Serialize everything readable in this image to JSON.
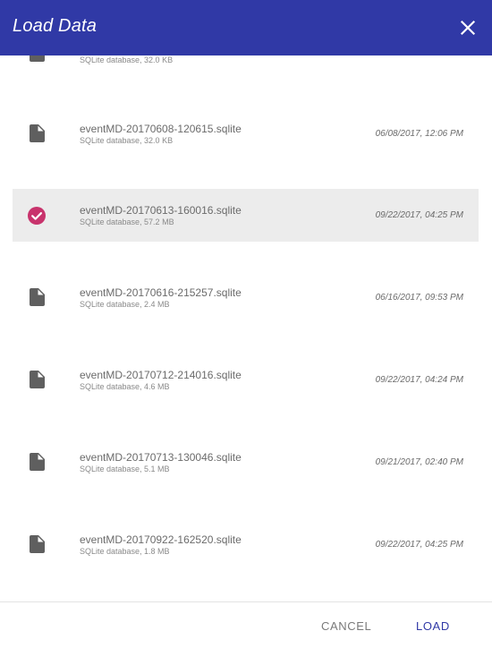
{
  "header": {
    "title": "Load Data",
    "close_icon": "close-icon"
  },
  "files": [
    {
      "name": "",
      "meta": "SQLite database, 32.0 KB",
      "date": "",
      "icon": "file-icon",
      "selected": false
    },
    {
      "name": "eventMD-20170608-120615.sqlite",
      "meta": "SQLite database, 32.0 KB",
      "date": "06/08/2017, 12:06 PM",
      "icon": "file-icon",
      "selected": false
    },
    {
      "name": "eventMD-20170613-160016.sqlite",
      "meta": "SQLite database, 57.2 MB",
      "date": "09/22/2017, 04:25 PM",
      "icon": "check-circle-icon",
      "selected": true
    },
    {
      "name": "eventMD-20170616-215257.sqlite",
      "meta": "SQLite database, 2.4 MB",
      "date": "06/16/2017, 09:53 PM",
      "icon": "file-icon",
      "selected": false
    },
    {
      "name": "eventMD-20170712-214016.sqlite",
      "meta": "SQLite database, 4.6 MB",
      "date": "09/22/2017, 04:24 PM",
      "icon": "file-icon",
      "selected": false
    },
    {
      "name": "eventMD-20170713-130046.sqlite",
      "meta": "SQLite database, 5.1 MB",
      "date": "09/21/2017, 02:40 PM",
      "icon": "file-icon",
      "selected": false
    },
    {
      "name": "eventMD-20170922-162520.sqlite",
      "meta": "SQLite database, 1.8 MB",
      "date": "09/22/2017, 04:25 PM",
      "icon": "file-icon",
      "selected": false
    }
  ],
  "footer": {
    "cancel_label": "CANCEL",
    "load_label": "LOAD"
  },
  "colors": {
    "header_bg": "#3039a6",
    "selected_check": "#c8336c",
    "selected_row_bg": "#ececec"
  }
}
